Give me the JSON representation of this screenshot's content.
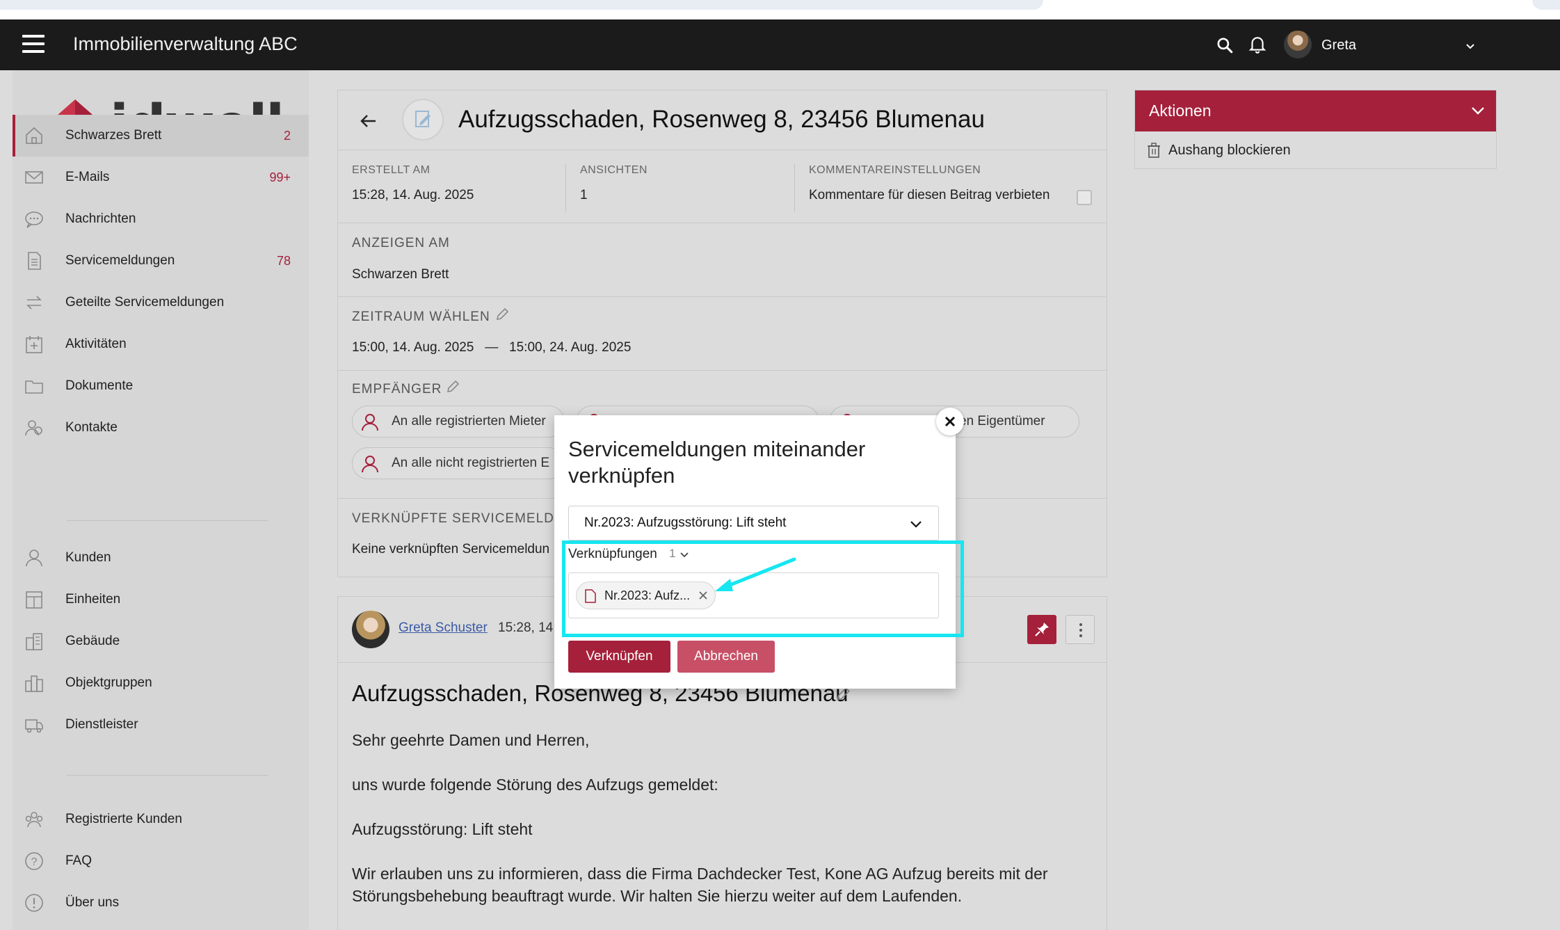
{
  "topbar": {
    "app_title": "Immobilienverwaltung ABC",
    "user_name": "Greta"
  },
  "logo": {
    "text": "idwell"
  },
  "sidebar": {
    "items": [
      {
        "label": "Schwarzes Brett",
        "badge": "2",
        "icon": "home-icon"
      },
      {
        "label": "E-Mails",
        "badge": "99+",
        "icon": "mail-icon"
      },
      {
        "label": "Nachrichten",
        "badge": "",
        "icon": "chat-icon"
      },
      {
        "label": "Servicemeldungen",
        "badge": "78",
        "icon": "document-icon"
      },
      {
        "label": "Geteilte Servicemeldungen",
        "badge": "",
        "icon": "swap-icon"
      },
      {
        "label": "Aktivitäten",
        "badge": "",
        "icon": "calendar-icon"
      },
      {
        "label": "Dokumente",
        "badge": "",
        "icon": "folder-icon"
      },
      {
        "label": "Kontakte",
        "badge": "",
        "icon": "contacts-icon"
      },
      {
        "label": "Kunden",
        "badge": "",
        "icon": "person-icon"
      },
      {
        "label": "Einheiten",
        "badge": "",
        "icon": "unit-icon"
      },
      {
        "label": "Gebäude",
        "badge": "",
        "icon": "building-icon"
      },
      {
        "label": "Objektgruppen",
        "badge": "",
        "icon": "buildings-icon"
      },
      {
        "label": "Dienstleister",
        "badge": "",
        "icon": "truck-icon"
      },
      {
        "label": "Registrierte Kunden",
        "badge": "",
        "icon": "group-icon"
      },
      {
        "label": "FAQ",
        "badge": "",
        "icon": "question-icon"
      },
      {
        "label": "Über uns",
        "badge": "",
        "icon": "info-icon"
      }
    ]
  },
  "post": {
    "title": "Aufzugsschaden, Rosenweg 8, 23456 Blumenau",
    "created_label": "ERSTELLT AM",
    "created_value": "15:28, 14. Aug. 2025",
    "views_label": "ANSICHTEN",
    "views_value": "1",
    "comments_label": "KOMMENTAREINSTELLUNGEN",
    "comments_value": "Kommentare für diesen Beitrag verbieten",
    "show_on_label": "ANZEIGEN AM",
    "show_on_value": "Schwarzen Brett",
    "period_label": "ZEITRAUM WÄHLEN",
    "period_value": "15:00, 14. Aug. 2025   —   15:00, 24. Aug. 2025",
    "recipients_label": "EMPFÄNGER",
    "recipients": [
      "An alle registrierten Mieter",
      "",
      "en Eigentümer",
      "An alle nicht registrierten E"
    ],
    "linked_label": "VERKNÜPFTE SERVICEMELDU",
    "linked_value": "Keine verknüpften Servicemeldun"
  },
  "comment": {
    "author": "Greta Schuster",
    "time": "15:28, 14",
    "title": "Aufzugsschaden, Rosenweg 8, 23456 Blumenau",
    "paragraphs": [
      "Sehr geehrte Damen und Herren,",
      "uns wurde folgende Störung des Aufzugs gemeldet:",
      "Aufzugsstörung: Lift steht",
      "Wir erlauben uns zu informieren, dass die Firma Dachdecker Test, Kone AG Aufzug bereits mit der Störungsbehebung beauftragt wurde. Wir halten Sie hierzu weiter auf dem Laufenden."
    ]
  },
  "actions": {
    "title": "Aktionen",
    "items": [
      "Aushang blockieren"
    ]
  },
  "modal": {
    "title": "Servicemeldungen miteinander verknüpfen",
    "select_value": "Nr.2023: Aufzugsstörung: Lift steht",
    "links_label": "Verknüpfungen",
    "links_count": "1",
    "link_chip": "Nr.2023: Aufz...",
    "confirm_label": "Verknüpfen",
    "cancel_label": "Abbrechen"
  },
  "colors": {
    "accent": "#a5203a",
    "topbar": "#1b1b1b",
    "highlight": "#17e6f0"
  }
}
